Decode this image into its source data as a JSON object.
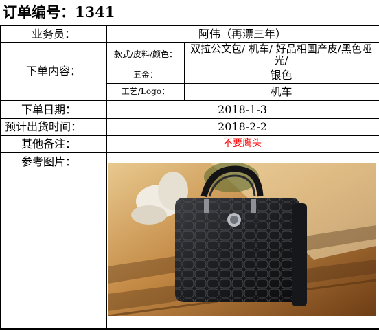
{
  "header": {
    "title": "订单编号：1341"
  },
  "rows": {
    "salesperson": {
      "label": "业务员：",
      "value": "阿伟（再漂三年）"
    },
    "order_content": {
      "label": "下单内容：",
      "style_label": "款式/皮料/颜色：",
      "style_value": "双拉公文包/ 机车/ 好品相国产皮/黑色哑光/",
      "hardware_label": "五金：",
      "hardware_value": "银色",
      "craft_label": "工艺/Logo：",
      "craft_value": "机车"
    },
    "order_date": {
      "label": "下单日期：",
      "value": "2018-1-3"
    },
    "ship_date": {
      "label": "预计出货时间：",
      "value": "2018-2-2"
    },
    "remarks": {
      "label": "其他备注：",
      "value": "不要鹰头"
    },
    "reference": {
      "label": "参考图片："
    }
  },
  "colors": {
    "remark_text": "#ff0000",
    "grid": "#000000"
  }
}
